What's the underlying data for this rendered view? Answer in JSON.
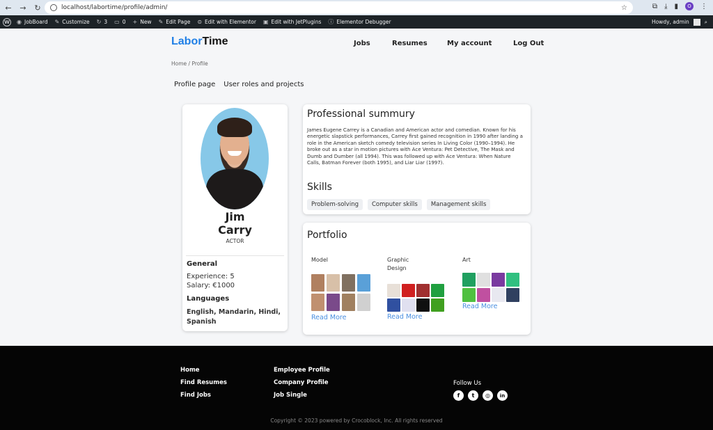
{
  "browser": {
    "url": "localhost/labortime/profile/admin/",
    "profile_initial": "O"
  },
  "admin_bar": {
    "items": [
      "JobBoard",
      "Customize",
      "3",
      "0",
      "New",
      "Edit Page",
      "Edit with Elementor",
      "Edit with JetPlugins",
      "Elementor Debugger"
    ],
    "greeting": "Howdy, admin"
  },
  "header": {
    "logo_part1": "Labor",
    "logo_part2": "Time",
    "nav": [
      "Jobs",
      "Resumes",
      "My account",
      "Log Out"
    ]
  },
  "breadcrumb": "Home / Profile",
  "tabs": [
    "Profile page",
    "User roles and projects"
  ],
  "profile": {
    "first_name": "Jim",
    "last_name": "Carry",
    "role": "ACTOR",
    "general_title": "General",
    "experience": "Experience: 5",
    "salary": "Salary: €1000",
    "languages_title": "Languages",
    "languages_line1": "English, Mandarin, Hindi,",
    "languages_line2": "Spanish"
  },
  "summary": {
    "title": "Professional summury",
    "text": "James Eugene Carrey is a Canadian and American actor and comedian. Known for his energetic slapstick performances, Carrey first gained recognition in 1990 after landing a role in the American sketch comedy television series In Living Color (1990–1994). He broke out as a star in motion pictures with Ace Ventura: Pet Detective, The Mask and Dumb and Dumber (all 1994). This was followed up with Ace Ventura: When Nature Calls, Batman Forever (both 1995), and Liar Liar (1997).",
    "skills_title": "Skills",
    "skills": [
      "Problem-solving",
      "Computer skills",
      "Management skills"
    ]
  },
  "portfolio": {
    "title": "Portfolio",
    "columns": [
      {
        "label": "Model",
        "read_more": "Read More",
        "tiles": [
          "#b08060",
          "#d8c0a8",
          "#807060",
          "#5aa0d8",
          "#c09070",
          "#7a4a8a",
          "#a08060",
          "#d0d0d0"
        ]
      },
      {
        "label": "Graphic Design",
        "read_more": "Read More",
        "tiles": [
          "#e8e0d8",
          "#d02020",
          "#a03030",
          "#20a040",
          "#3050a0",
          "#e0e0f0",
          "#101010",
          "#40a020"
        ]
      },
      {
        "label": "Art",
        "read_more": "Read More",
        "tiles": [
          "#20a060",
          "#e0e0e0",
          "#7a3aa0",
          "#30c080",
          "#50c040",
          "#c050a0",
          "#e8e8f0",
          "#304060"
        ]
      }
    ]
  },
  "footer": {
    "col1": [
      "Home",
      "Find Resumes",
      "Find Jobs"
    ],
    "col2": [
      "Employee Profile",
      "Company Profile",
      "Job Single"
    ],
    "follow": "Follow Us",
    "social": [
      "f",
      "t",
      "◎",
      "in"
    ],
    "copyright": "Copyright © 2023 powered by Crocoblock, Inc. All rights reserved"
  },
  "colors": {
    "brand_blue": "#1f7fe6",
    "link_blue": "#4a8fe0",
    "footer_bg": "#050505",
    "admin_bar_bg": "#1d2327"
  }
}
